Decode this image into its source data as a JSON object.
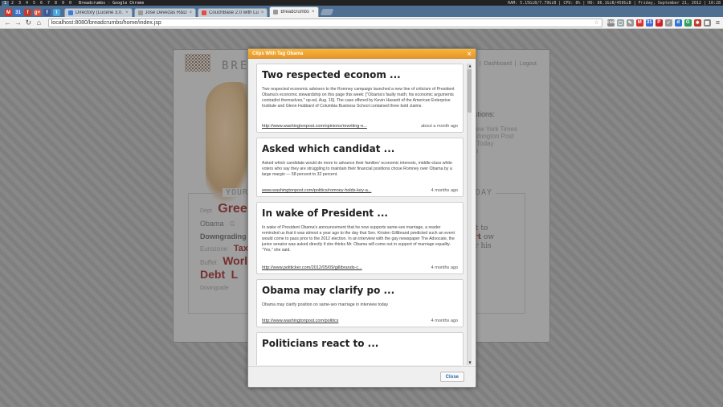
{
  "system_bar": {
    "workspaces": [
      "1",
      "2",
      "3",
      "4",
      "5",
      "6",
      "7",
      "8",
      "9",
      "0"
    ],
    "window_title": "Breadcrumbs - Google Chrome",
    "stats": "RAM: 5.15GiB/7.79GiB | CPU: 8% | HD: 86.1GiB/450GiB | Friday, September 21, 2012 | 10:28"
  },
  "browser": {
    "pinned": [
      {
        "icon": "gmail-icon",
        "glyph": "M",
        "color": "#d93025"
      },
      {
        "icon": "calendar-icon",
        "glyph": "31",
        "color": "#3b6fd4"
      },
      {
        "icon": "feedly-icon",
        "glyph": "f",
        "color": "#c0392b"
      },
      {
        "icon": "gplus-icon",
        "glyph": "g+",
        "color": "#dd4b39"
      },
      {
        "icon": "facebook-icon",
        "glyph": "f",
        "color": "#3b5998"
      },
      {
        "icon": "twitter-icon",
        "glyph": "t",
        "color": "#4aa8e0"
      }
    ],
    "tabs": [
      {
        "label": "Directory (Lucene 3.0.",
        "active": false,
        "favcolor": "#3b7dd8"
      },
      {
        "label": "José Devezas R&D",
        "active": false,
        "favcolor": "#9a9a9a"
      },
      {
        "label": "CouchBase 2.0 with Lu",
        "active": false,
        "favcolor": "#e74c3c"
      },
      {
        "label": "Breadcrumbs",
        "active": true,
        "favcolor": "#9a9a9a"
      }
    ],
    "url": "localhost:8080/breadcrumbs/home/index.jsp",
    "extensions": [
      {
        "icon": "css-icon",
        "glyph": "css",
        "color": "#888"
      },
      {
        "icon": "page-icon",
        "glyph": "▢",
        "color": "#9aa"
      },
      {
        "icon": "pencil-icon",
        "glyph": "✎",
        "color": "#999"
      },
      {
        "icon": "gmail-ext-icon",
        "glyph": "M",
        "color": "#d93025"
      },
      {
        "icon": "calendar-ext-icon",
        "glyph": "31",
        "color": "#3b6fd4"
      },
      {
        "icon": "pinterest-icon",
        "glyph": "P",
        "color": "#cb2027"
      },
      {
        "icon": "pocket-icon",
        "glyph": "✓",
        "color": "#9a9a9a"
      },
      {
        "icon": "delicious-icon",
        "glyph": "d",
        "color": "#3274d0"
      },
      {
        "icon": "gmaps-icon",
        "glyph": "G",
        "color": "#2e9e5a"
      },
      {
        "icon": "lastpass-icon",
        "glyph": "✱",
        "color": "#c0392b"
      },
      {
        "icon": "grid-icon",
        "glyph": "▦",
        "color": "#888"
      }
    ]
  },
  "app": {
    "brand": "BREA",
    "nav": [
      "|",
      "Dashboard",
      "|",
      "Logout"
    ],
    "suggestions_title": "ggestions:",
    "suggestions": [
      "New York Times",
      "ashington Post",
      "a Today",
      "es"
    ],
    "your_heading": "YOUR T",
    "trending_heading": "DING TODAY",
    "cloud": [
      "Dept",
      "Gree",
      "Obama",
      "G",
      "Downgrading",
      "Eurozone",
      "Tax",
      "Buffet",
      "World",
      "Debt",
      "L",
      "Downgrade"
    ],
    "trend_msg": "ags are yet to aited.",
    "trend_start": "Start",
    "trend_msg2": "ow to see your his cloud!"
  },
  "modal": {
    "title": "Clips With Tag Obama",
    "close_label": "Close",
    "clips": [
      {
        "title": "Two respected econom ...",
        "text": "Two respected economic advisers to the Romney campaign launched a new line of criticism of President Obama's economic stewardship on this page this week: [\"Obama's faulty math; his economic arguments contradict themselves,\" op-ed, Aug. 16]. The case offered by Kevin Hassett of the American Enterprise Institute and Glenn Hubbard of Columbia Business School contained three bold claims.",
        "link": "http://www.washingtonpost.com/opinions/rewriting-e...",
        "age": "about a month ago"
      },
      {
        "title": "Asked which candidat ...",
        "text": "Asked which candidate would do more to advance their families' economic interests, middle-class white voters who say they are struggling to maintain their financial positions chose Romney over Obama by a large margin — 58 percent to 32 percent.",
        "link": "www.washingtonpost.com/politics/romney-holds-key-a...",
        "age": "4 months ago"
      },
      {
        "title": "In wake of President ...",
        "text": "In wake of President Obama's announcement that he now supports same-sex marriage, a reader reminded us that it was almost a year ago to the day that Sen. Kirsten Gillibrand predicted such an event would come to pass prior to the 2012 election. In an interview with the gay newspaper The Advocate, the junior senator was asked directly if she thinks Mr. Obama will come out in support of marriage equality. \"Yes,\" she said.",
        "link": "http://www.politicker.com/2012/05/09/gillibrands-c...",
        "age": "4 months ago"
      },
      {
        "title": "Obama may clarify po ...",
        "text": "Obama may clarify position on same-sex marriage in interview today",
        "link": "http://www.washingtonpost.com/politics",
        "age": "4 months ago"
      },
      {
        "title": "Politicians react to ...",
        "text": "",
        "link": "",
        "age": ""
      }
    ]
  }
}
